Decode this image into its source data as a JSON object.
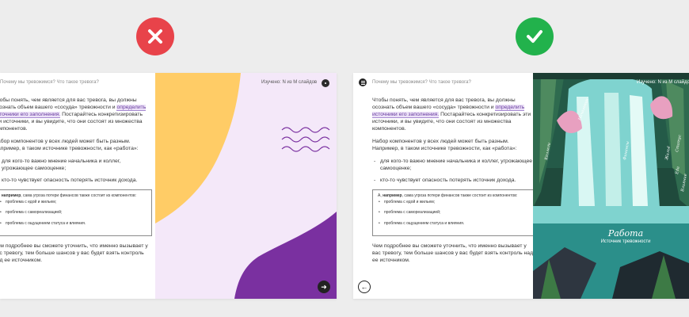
{
  "verdict": {
    "bad_icon": "cross-icon",
    "good_icon": "check-icon",
    "bad_color": "#e8434a",
    "good_color": "#22b24c"
  },
  "slide_common": {
    "question_title": "Почему мы тревожимся? Что такое тревога?",
    "studied": "Изучено:  N  из  M  слайдов",
    "para1_before": "Чтобы понять, чем является для вас тревога, вы должны осознать объем вашего «сосуда» тревожности и ",
    "para1_highlight": "определить источники его заполнения.",
    "para1_after": " Постарайтесь конкретизировать эти источники, и вы увидите, что они состоят из множества компонентов.",
    "para2": "Набор компонентов у всех людей может быть разным. Например, в таком источнике тревожности, как «работа»:",
    "bullet1": "для кого-то важно мнение начальника и коллег, угрожающее самооценке;",
    "bullet2": "кто-то чувствует опасность потерять источник дохода.",
    "box_lead_bold": "например",
    "box_lead_before": "А, ",
    "box_lead_after": ", сама угроза потери финансов также состоит из компонентов:",
    "box_items": [
      "проблема с едой и жильем;",
      "проблема с самореализацией;",
      "проблема с ощущением статуса и влияния."
    ],
    "para3": "Чем подробнее вы сможете уточнить, что именно вызывает у вас тревогу, тем больше шансов у вас будет взять контроль над ее источником."
  },
  "left_slide": {
    "box_lead_before": ", ",
    "accent_colors": {
      "yellow": "#ffcc66",
      "purple": "#7a30a0",
      "lilac": "#f4e8f9"
    },
    "next_icon": "arrow-right-icon"
  },
  "right_slide": {
    "scene_title": "Работа",
    "scene_subtitle": "Источник тревожности",
    "waterfall_words": [
      "Начальник",
      "Коллеги",
      "Финансы",
      "Статус",
      "Жильё",
      "Еда",
      "Влияние"
    ],
    "prev_icon": "arrow-left-icon",
    "menu_icon": "menu-icon"
  }
}
